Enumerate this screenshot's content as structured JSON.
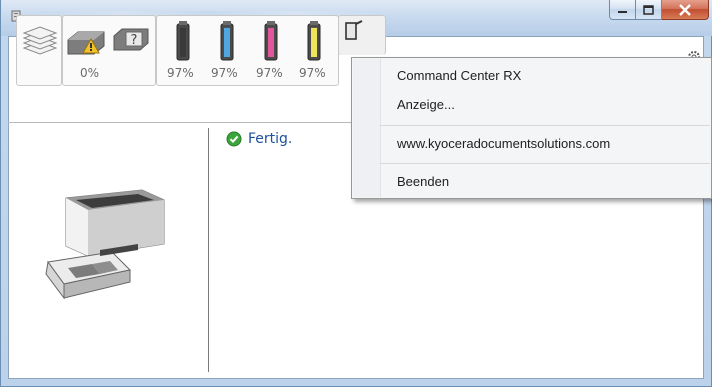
{
  "window": {
    "title_obscured": true,
    "buttons": {
      "minimize": "minimize-icon",
      "maximize": "maximize-icon",
      "close": "close-icon"
    }
  },
  "toolbar": {
    "paper": {
      "icon": "paper-stack-icon"
    },
    "alerts": {
      "icons": [
        "toner-warning-icon",
        "unknown-status-icon"
      ],
      "percent": "0%"
    },
    "toners": [
      {
        "name": "black",
        "color": "#3a3a3a",
        "percent": "97%",
        "level": 0.97
      },
      {
        "name": "cyan",
        "color": "#4ea7e0",
        "percent": "97%",
        "level": 0.97
      },
      {
        "name": "magenta",
        "color": "#e2569e",
        "percent": "97%",
        "level": 0.97
      },
      {
        "name": "yellow",
        "color": "#efe35a",
        "percent": "97%",
        "level": 0.97
      }
    ]
  },
  "status": {
    "text": "Fertig.",
    "icon": "check-circle-icon",
    "color": "#1d51a0"
  },
  "printer": {
    "icon": "printer-icon"
  },
  "menu": {
    "items": [
      {
        "label": "Command Center RX"
      },
      {
        "label": "Anzeige..."
      },
      {
        "label": "www.kyoceradocumentsolutions.com"
      },
      {
        "label": "Beenden"
      }
    ]
  }
}
